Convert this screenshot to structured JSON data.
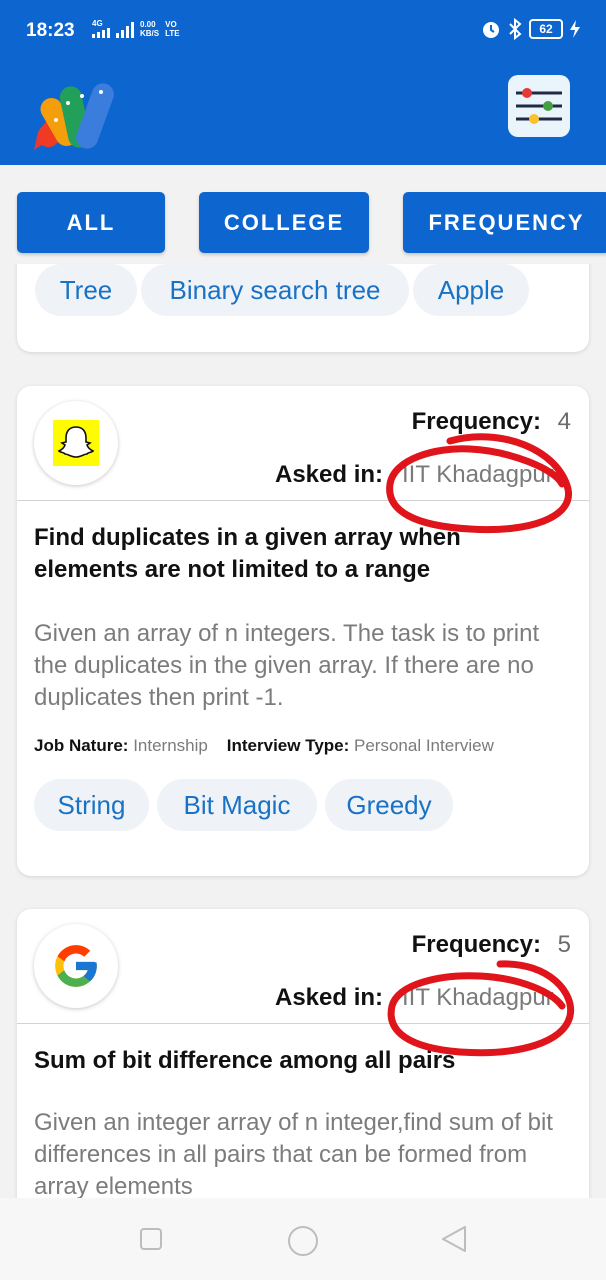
{
  "status_bar": {
    "time": "18:23",
    "network_label": "4G",
    "speed_value": "0.00",
    "speed_unit": "KB/S",
    "volte_top": "VO",
    "volte_bottom": "LTE",
    "battery": "62",
    "icons": [
      "alarm-icon",
      "bluetooth-icon",
      "battery-icon",
      "charging-icon"
    ]
  },
  "app_bar": {
    "logo_icon": "app-logo-icon",
    "filter_icon": "filter-sliders-icon"
  },
  "filter_buttons": [
    "ALL",
    "COLLEGE",
    "FREQUENCY"
  ],
  "partial_card": {
    "tags": [
      "Tree",
      "Binary search tree",
      "Apple"
    ]
  },
  "cards": [
    {
      "company_icon": "snapchat-icon",
      "frequency_label": "Frequency:",
      "frequency_value": "4",
      "asked_label": "Asked in:",
      "asked_value": "IIT Khadagpur",
      "title": "Find duplicates in a given array when elements are not limited to a range",
      "description": "Given an array of n integers. The task is to print the duplicates in the given array. If there are no duplicates then print -1.",
      "job_nature_label": "Job Nature:",
      "job_nature_value": "Internship",
      "interview_type_label": "Interview Type:",
      "interview_type_value": "Personal Interview",
      "tags": [
        "String",
        "Bit Magic",
        "Greedy"
      ]
    },
    {
      "company_icon": "google-icon",
      "frequency_label": "Frequency:",
      "frequency_value": "5",
      "asked_label": "Asked in:",
      "asked_value": "IIT Khadagpur",
      "title": "Sum of bit difference among all pairs",
      "description": "Given an integer array of n integer,find sum of bit differences in all pairs that can be formed from array elements"
    }
  ],
  "nav_bar": {
    "icons": [
      "recents-square-icon",
      "home-circle-icon",
      "back-triangle-icon"
    ]
  },
  "colors": {
    "primary": "#0d66d0",
    "tag_text": "#1a72c4",
    "tag_bg": "#eff3f8",
    "annotation": "#e0141b"
  }
}
